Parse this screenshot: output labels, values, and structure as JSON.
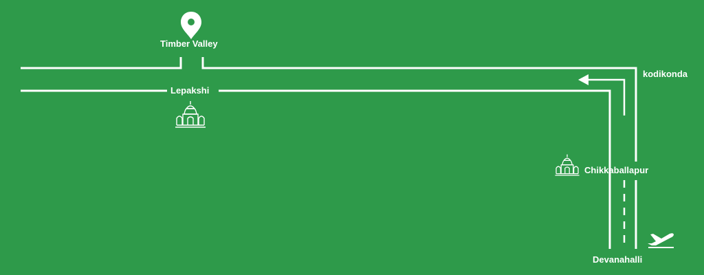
{
  "map": {
    "background_color": "#2e9a4a",
    "road_color": "#ffffff",
    "places": {
      "timber_valley": {
        "label": "Timber Valley",
        "icon": "location-pin-icon"
      },
      "lepakshi": {
        "label": "Lepakshi",
        "icon": "temple-icon"
      },
      "kodikonda": {
        "label": "kodikonda"
      },
      "chikkaballapur": {
        "label": "Chikkaballapur",
        "icon": "temple-icon"
      },
      "devanahalli": {
        "label": "Devanahalli",
        "icon": "airplane-takeoff-icon"
      }
    },
    "route_direction": "north-west"
  }
}
